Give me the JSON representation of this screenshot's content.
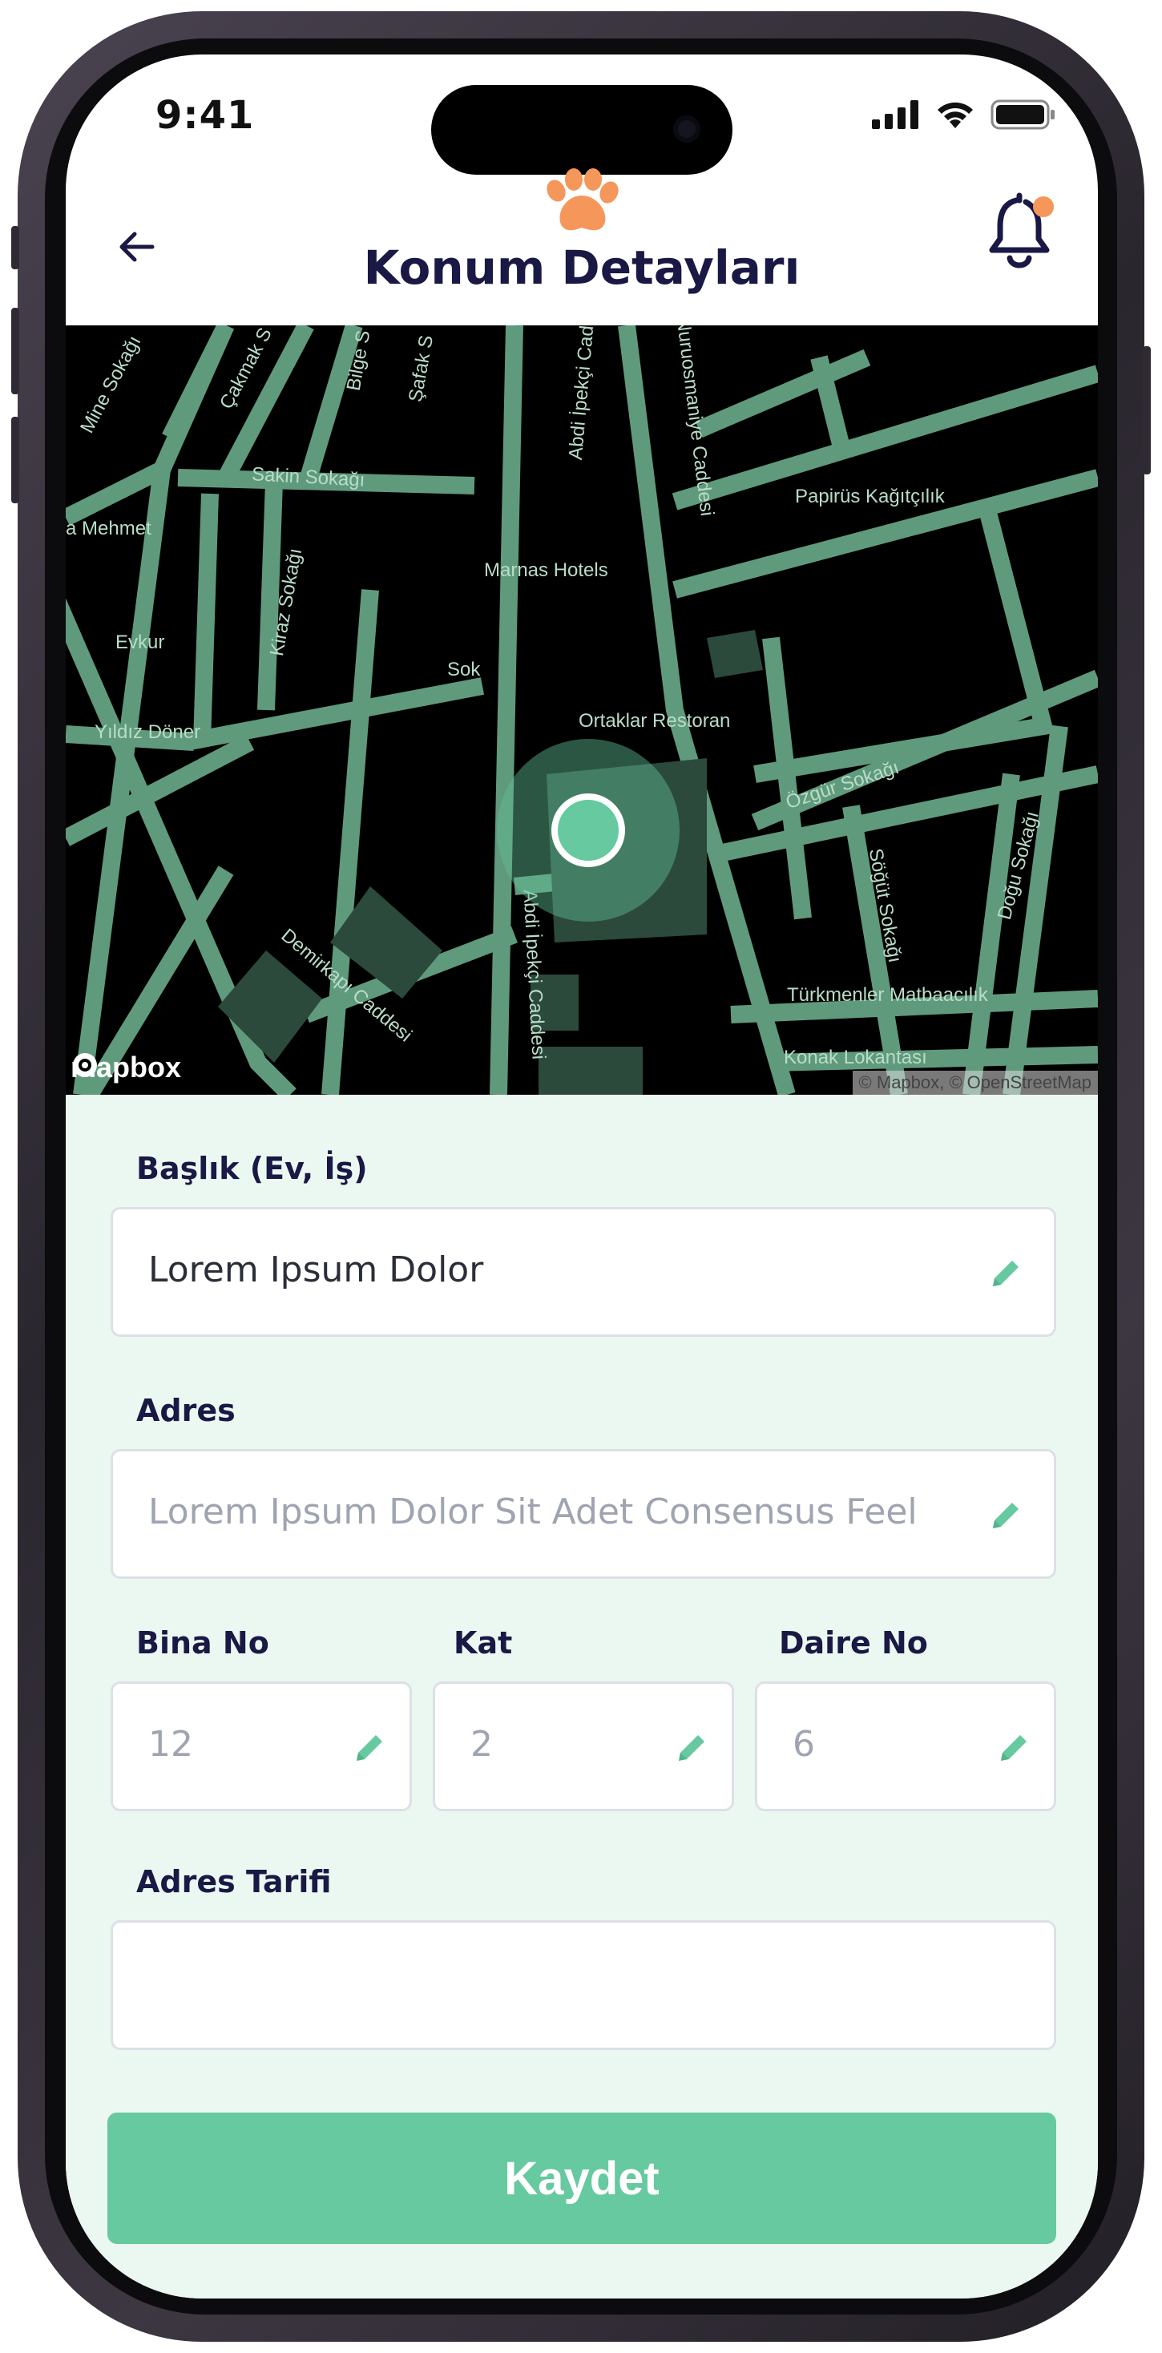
{
  "status_bar": {
    "time": "9:41"
  },
  "header": {
    "title": "Konum Detayları"
  },
  "map": {
    "labels": {
      "mine_sokagi": "Mine Sokağı",
      "cakmak": "Çakmak S",
      "bilge": "Bilge S",
      "safak": "Şafak S",
      "abdi_ipekci_top": "Abdi İpekçi Cad",
      "nuruosmaniye": "Nuruosmaniye Caddesi",
      "sakin_sokagi": "Sakin Sokağı",
      "mehmet": "a Mehmet",
      "marnas": "Marnas Hotels",
      "papirus": "Papirüs Kağıtçılık",
      "evkur": "Evkur",
      "kiraz": "Kiraz Sokağı",
      "sok": "Sok",
      "yildiz": "Yıldız Döner",
      "ortaklar": "Ortaklar Restoran",
      "ozgur": "Özgür Sokağı",
      "sogut": "Söğüt Sokağı",
      "dogu": "Doğu Sokağı",
      "abdi_ipekci_bottom": "Abdi İpekçi Caddesi",
      "demirkapi": "Demirkapı Caddesi",
      "turkmenler": "Türkmenler Matbaacılık",
      "konak": "Konak Lokantası"
    },
    "brand": "mapbox",
    "attribution": "© Mapbox, © OpenStreetMap"
  },
  "form": {
    "baslik_label": "Başlık (Ev, İş)",
    "baslik_value": "Lorem Ipsum Dolor",
    "adres_label": "Adres",
    "adres_placeholder": "Lorem Ipsum Dolor Sit Adet Consensus Feel",
    "bina_label": "Bina No",
    "bina_placeholder": "12",
    "kat_label": "Kat",
    "kat_placeholder": "2",
    "daire_label": "Daire No",
    "daire_placeholder": "6",
    "tarif_label": "Adres Tarifi",
    "tarif_value": "",
    "save_label": "Kaydet"
  },
  "colors": {
    "accent": "#66c9a0",
    "title": "#1a1845",
    "logo": "#f5975a",
    "notification_dot": "#f5975a",
    "form_bg": "#ebf8f1"
  },
  "icons": {
    "back": "arrow-left-icon",
    "logo": "paw-icon",
    "notifications": "bell-icon",
    "edit": "pencil-icon"
  }
}
